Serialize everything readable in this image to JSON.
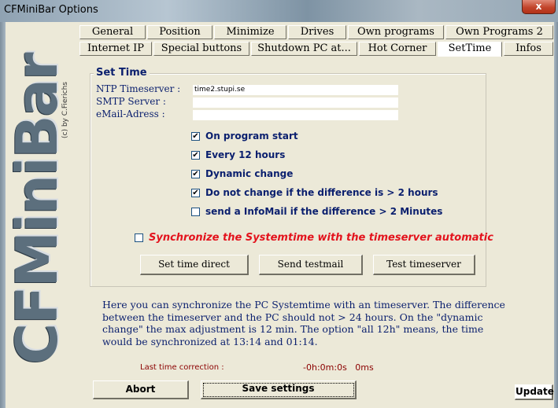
{
  "window": {
    "title": "CFMiniBar Options",
    "close_glyph": "x"
  },
  "logo": {
    "text": "CFMiniBar",
    "copyright": "(c) by C.Fierichs"
  },
  "tabs_row1": [
    "General",
    "Position",
    "Minimize",
    "Drives",
    "Own programs",
    "Own Programs 2"
  ],
  "tabs_row2": [
    "Internet IP",
    "Special buttons",
    "Shutdown PC at...",
    "Hot Corner",
    "SetTime",
    "Infos"
  ],
  "active_tab": "SetTime",
  "settime": {
    "group_title": "Set Time",
    "ntp_label": "NTP Timeserver :",
    "ntp_value": "time2.stupi.se",
    "smtp_label": "SMTP Server :",
    "smtp_value": "",
    "email_label": "eMail-Adress :",
    "email_value": "",
    "options": [
      {
        "label": "On program start",
        "checked": true
      },
      {
        "label": "Every 12 hours",
        "checked": true
      },
      {
        "label": "Dynamic change",
        "checked": true
      },
      {
        "label": "Do not change if the difference is > 2 hours",
        "checked": true
      },
      {
        "label": "send a InfoMail if the difference > 2 Minutes",
        "checked": false
      }
    ],
    "sync_auto_label": "Synchronize the Systemtime with the timeserver automatic",
    "sync_auto_checked": false,
    "buttons": {
      "set_time_direct": "Set time direct",
      "send_testmail": "Send testmail",
      "test_timeserver": "Test timeserver"
    },
    "info_text": "Here you can synchronize the PC Systemtime with an timeserver. The difference between the timeserver and the PC should not > 24 hours. On the \"dynamic change\" the max adjustment is 12 min. The option \"all 12h\" means, the time would be synchronized at 13:14 and 01:14.",
    "last_correction_label": "Last time correction :",
    "last_correction_value": "-0h:0m:0s   0ms"
  },
  "footer": {
    "abort": "Abort",
    "save": "Save settings",
    "update": "Update"
  },
  "colors": {
    "label_blue": "#0a1f6e",
    "warning_red": "#e3131d",
    "dark_red": "#8b0000",
    "face": "#ece9d8"
  }
}
